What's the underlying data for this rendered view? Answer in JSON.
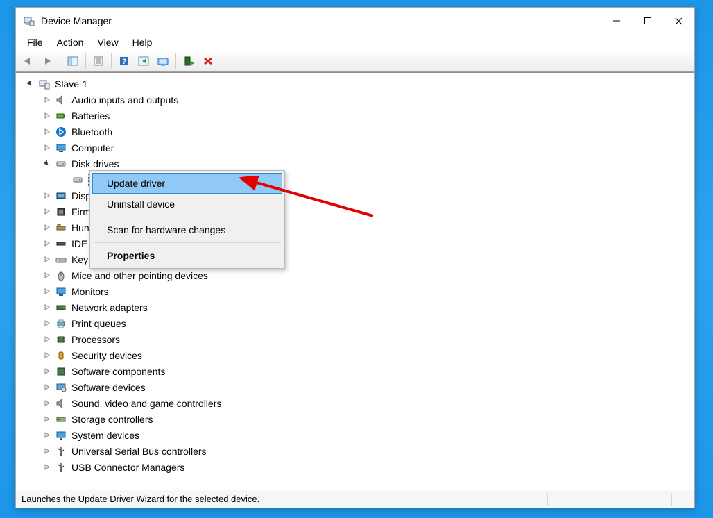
{
  "window": {
    "title": "Device Manager"
  },
  "menubar": {
    "file": "File",
    "action": "Action",
    "view": "View",
    "help": "Help"
  },
  "tree": {
    "root": "Slave-1",
    "items": [
      "Audio inputs and outputs",
      "Batteries",
      "Bluetooth",
      "Computer",
      "Disk drives",
      "Display adapters",
      "Firmware",
      "Human Interface Devices",
      "IDE ATA/ATAPI controllers",
      "Keyboards",
      "Mice and other pointing devices",
      "Monitors",
      "Network adapters",
      "Print queues",
      "Processors",
      "Security devices",
      "Software components",
      "Software devices",
      "Sound, video and game controllers",
      "Storage controllers",
      "System devices",
      "Universal Serial Bus controllers",
      "USB Connector Managers"
    ],
    "disk_drive_child_partial": "I",
    "truncations": {
      "display": "Disp",
      "firmware": "Firm",
      "hid": "Hun",
      "ide": "IDE .",
      "keyboards": "Keyl"
    }
  },
  "context_menu": {
    "update": "Update driver",
    "uninstall": "Uninstall device",
    "scan": "Scan for hardware changes",
    "properties": "Properties"
  },
  "statusbar": {
    "text": "Launches the Update Driver Wizard for the selected device."
  }
}
